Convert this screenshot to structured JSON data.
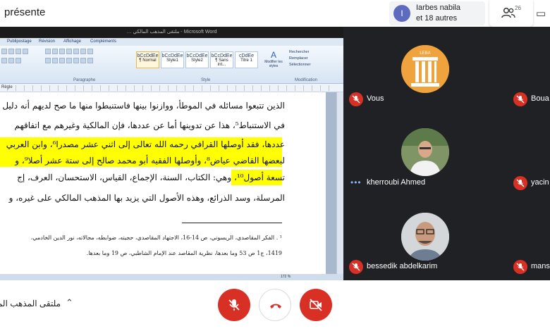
{
  "topbar": {
    "presenter_title": "présente",
    "participant_pill": {
      "avatar_letter": "I",
      "line1": "Iarbes nabila",
      "line2": "et 18 autres"
    },
    "people_count": "26"
  },
  "word": {
    "title": "… ملتقى المذهب المالكي - Microsoft Word",
    "tabs": [
      "Publipostage",
      "Révision",
      "Affichage",
      "Compléments"
    ],
    "styles": [
      {
        "sample": "bCcDdEe",
        "label": "¶ Normal"
      },
      {
        "sample": "bCcDdEe",
        "label": "Style1"
      },
      {
        "sample": "bCcDdEe",
        "label": "Style2"
      },
      {
        "sample": "bCcDdEe",
        "label": "¶ Sans int..."
      },
      {
        "sample": "cDdEe",
        "label": "Titre 1"
      }
    ],
    "group_paragraphe": "Paragraphe",
    "group_style": "Style",
    "group_modification": "Modification",
    "change_styles": "Modifier les styles",
    "edit_items": [
      "Rechercher",
      "Remplacer",
      "Sélectionner"
    ],
    "ruler_prefix": "Règle",
    "zoom": "172 %",
    "lines": [
      "الذين تتبعوا مسائله في الموطأ، ووازنوا بينها فاستنبطوا منها ما صح لديهم أنه دليل",
      "في الاستنباط⁵، هذا عن تدوينها أما عن عددها، فإن المالكية وغيرهم مع اتفاقهم",
      "عددها، فقد أوصلها القرافي رحمه الله تعالى إلى اثني عشر مصدرا⁶، وابن العربي",
      "لبعضها القاضي عياض⁸، وأوصلها الفقيه أبو محمد صالح إلى ستة عشر أصلا⁹، و",
      "تسعة أصول¹⁰، وهي: الكتاب، السنة، الإجماع، القياس، الاستحسان، العرف، إج",
      "المرسلة، وسد الذرائع، وهذه الأصول التي يزيد بها المذهب المالكي على غيره، و"
    ],
    "footnotes": [
      "¹ . الفكر المقاصدي، الريسوني، ص 14-16، الاجتهاد المقاصدي، حجيته، ضوابطه، مجالاته، نور الدين الخادمي،",
      "1419، ج1 ص 53 وما بعدها، نظرية المقاصد عند الإمام الشاطبي، ص 19 وما بعدها."
    ]
  },
  "participants": [
    {
      "name": "Vous",
      "muted": true
    },
    {
      "name": "Boua",
      "muted": true
    },
    {
      "name": "kherroubi Ahmed",
      "muted": false
    },
    {
      "name": "yacin",
      "muted": true
    },
    {
      "name": "bessedik abdelkarim",
      "muted": true
    },
    {
      "name": "mans",
      "muted": true
    }
  ],
  "bottombar": {
    "meeting_name": "ملتقى المذهب المال"
  },
  "colors": {
    "tile_bg": "#202124",
    "red": "#d93025",
    "highlight": "#ffff00",
    "logo_orange": "#f0a23c"
  }
}
